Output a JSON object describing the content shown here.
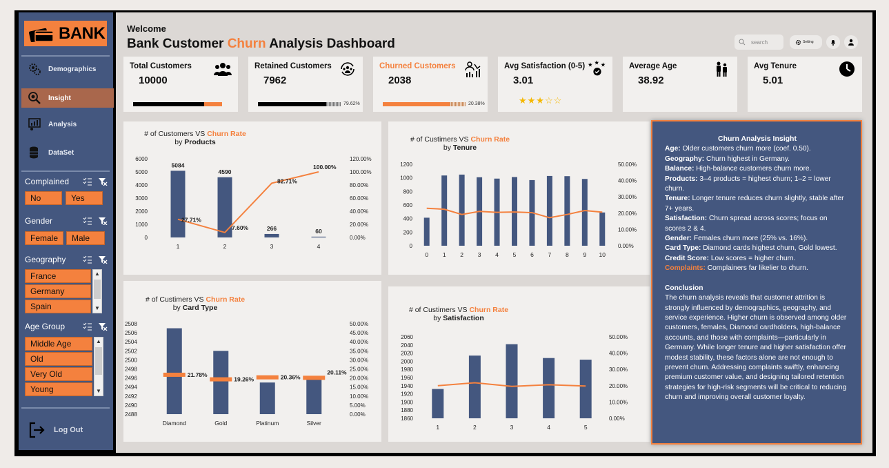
{
  "sidebar": {
    "logo": "BANK",
    "nav": [
      {
        "label": "Demographics",
        "icon": "gears-user-icon"
      },
      {
        "label": "Insight",
        "icon": "lightbulb-search-icon"
      },
      {
        "label": "Analysis",
        "icon": "analysis-chart-icon"
      },
      {
        "label": "DataSet",
        "icon": "database-icon"
      }
    ],
    "filters": {
      "complained": {
        "label": "Complained",
        "options": [
          "No",
          "Yes"
        ]
      },
      "gender": {
        "label": "Gender",
        "options": [
          "Female",
          "Male"
        ]
      },
      "geography": {
        "label": "Geography",
        "options": [
          "France",
          "Germany",
          "Spain"
        ]
      },
      "age_group": {
        "label": "Age Group",
        "options": [
          "Middle Age",
          "Old",
          "Very Old",
          "Young"
        ]
      }
    },
    "logout": "Log Out"
  },
  "header": {
    "welcome": "Welcome",
    "title_pre": "Bank Customer ",
    "title_accent": "Churn",
    "title_post": " Analysis Dashboard",
    "search_placeholder": "search",
    "setting_label": "Setting"
  },
  "kpis": {
    "total": {
      "label": "Total Customers",
      "value": "10000"
    },
    "retained": {
      "label": "Retained Customers",
      "value": "7962",
      "pct": "79.62%",
      "fraction": 0.7962
    },
    "churned": {
      "label": "Churned Customers",
      "value": "2038",
      "pct": "20.38%",
      "fraction": 0.2038
    },
    "satisfaction": {
      "label": "Avg Satisfaction (0-5)",
      "value": "3.01",
      "stars": "★★★☆☆",
      "rating": 3
    },
    "age": {
      "label": "Average Age",
      "value": "38.92"
    },
    "tenure": {
      "label": "Avg Tenure",
      "value": "5.01"
    }
  },
  "colors": {
    "accent": "#f4813e",
    "bar": "#44577f",
    "sidebar": "#44577f"
  },
  "chart_titles": {
    "products": {
      "pre": "# of Customers VS ",
      "acc": "Churn Rate",
      "by": "by ",
      "dim": "Products"
    },
    "tenure": {
      "pre": "# of Custimers VS ",
      "acc": "Churn Rate",
      "by": "by ",
      "dim": "Tenure"
    },
    "card": {
      "pre": "# of Custimers VS ",
      "acc": "Churn Rate",
      "by": "by ",
      "dim": "Card Type"
    },
    "satisfaction": {
      "pre": "# of Custimers VS ",
      "acc": "Churn Rate",
      "by": "by ",
      "dim": "Satisfaction"
    }
  },
  "chart_data": [
    {
      "type": "bar+line",
      "categories": [
        "1",
        "2",
        "3",
        "4"
      ],
      "series": [
        {
          "values": [
            5084,
            4590,
            266,
            60
          ],
          "axis": "left"
        },
        {
          "values": [
            27.71,
            7.6,
            82.71,
            100.0
          ],
          "axis": "right"
        }
      ],
      "bar_labels": [
        "5084",
        "4590",
        "266",
        "60"
      ],
      "line_labels": [
        "27.71%",
        "7.60%",
        "82.71%",
        "100.00%"
      ],
      "left_ticks": [
        "6000",
        "5000",
        "4000",
        "3000",
        "2000",
        "1000",
        "0"
      ],
      "right_ticks": [
        "120.00%",
        "100.00%",
        "80.00%",
        "60.00%",
        "40.00%",
        "20.00%",
        "0.00%"
      ],
      "ylim_left": [
        0,
        6000
      ],
      "ylim_right": [
        0,
        120
      ]
    },
    {
      "type": "bar+line",
      "categories": [
        "0",
        "1",
        "2",
        "3",
        "4",
        "5",
        "6",
        "7",
        "8",
        "9",
        "10"
      ],
      "series": [
        {
          "values": [
            413,
            1035,
            1048,
            1009,
            989,
            1012,
            967,
            1028,
            1025,
            984,
            490
          ],
          "axis": "left"
        },
        {
          "values": [
            23.0,
            22.4,
            19.2,
            21.1,
            20.5,
            20.7,
            20.3,
            17.2,
            19.2,
            21.6,
            20.6
          ],
          "axis": "right"
        }
      ],
      "left_ticks": [
        "1200",
        "1000",
        "800",
        "600",
        "400",
        "200",
        "0"
      ],
      "right_ticks": [
        "50.00%",
        "40.00%",
        "30.00%",
        "20.00%",
        "10.00%",
        "0.00%"
      ],
      "ylim_left": [
        0,
        1200
      ],
      "ylim_right": [
        0,
        50
      ]
    },
    {
      "type": "bar+line",
      "categories": [
        "Diamond",
        "Gold",
        "Platinum",
        "Silver"
      ],
      "series": [
        {
          "values": [
            2507,
            2502,
            2495,
            2496
          ],
          "axis": "left"
        },
        {
          "values": [
            21.78,
            19.26,
            20.36,
            20.11
          ],
          "axis": "right"
        }
      ],
      "line_labels": [
        "21.78%",
        "19.26%",
        "20.36%",
        "20.11%"
      ],
      "left_ticks": [
        "2508",
        "2506",
        "2504",
        "2502",
        "2500",
        "2498",
        "2496",
        "2494",
        "2492",
        "2490",
        "2488"
      ],
      "right_ticks": [
        "50.00%",
        "45.00%",
        "40.00%",
        "35.00%",
        "30.00%",
        "25.00%",
        "20.00%",
        "15.00%",
        "10.00%",
        "5.00%",
        "0.00%"
      ],
      "ylim_left": [
        2488,
        2508
      ],
      "ylim_right": [
        0,
        50
      ]
    },
    {
      "type": "bar+line",
      "categories": [
        "1",
        "2",
        "3",
        "4",
        "5"
      ],
      "series": [
        {
          "values": [
            1932,
            2014,
            2042,
            2008,
            2004
          ],
          "axis": "left"
        },
        {
          "values": [
            20.0,
            21.8,
            19.6,
            20.6,
            19.8
          ],
          "axis": "right"
        }
      ],
      "left_ticks": [
        "2060",
        "2040",
        "2020",
        "2000",
        "1980",
        "1960",
        "1940",
        "1920",
        "1900",
        "1880",
        "1860"
      ],
      "right_ticks": [
        "50.00%",
        "40.00%",
        "30.00%",
        "20.00%",
        "10.00%",
        "0.00%"
      ],
      "ylim_left": [
        1860,
        2060
      ],
      "ylim_right": [
        0,
        50
      ]
    }
  ],
  "insight": {
    "title": "Churn Analysis  Insight",
    "items": [
      {
        "k": "Age:",
        "v": " Older customers churn more (coef. 0.50)."
      },
      {
        "k": "Geography:",
        "v": " Churn highest in Germany."
      },
      {
        "k": "Balance:",
        "v": " High-balance customers churn more."
      },
      {
        "k": "Products:",
        "v": " 3–4 products = highest churn; 1–2 = lower churn."
      },
      {
        "k": "Tenure:",
        "v": " Longer tenure reduces churn slightly, stable after 7+ years."
      },
      {
        "k": "Satisfaction:",
        "v": " Churn spread across scores; focus on scores 2 & 4."
      },
      {
        "k": "Gender:",
        "v": " Females churn more (25% vs. 16%)."
      },
      {
        "k": "Card Type:",
        "v": " Diamond cards highest churn, Gold lowest."
      },
      {
        "k": "Credit Score:",
        "v": " Low scores = higher churn."
      }
    ],
    "complaints_k": "Complaints:",
    "complaints_v": " Complainers far likelier to churn.",
    "conclusion_title": "Conclusion",
    "conclusion": "The churn analysis reveals that customer attrition is strongly influenced by demographics, geography, and service experience. Higher churn is observed among older customers, females, Diamond cardholders, high-balance accounts, and those with complaints—particularly in Germany. While longer tenure and higher satisfaction offer modest stability, these factors alone are not enough to prevent churn. Addressing complaints swiftly, enhancing premium customer value, and designing tailored retention strategies for high-risk segments will be critical to reducing churn and improving overall customer loyalty."
  }
}
